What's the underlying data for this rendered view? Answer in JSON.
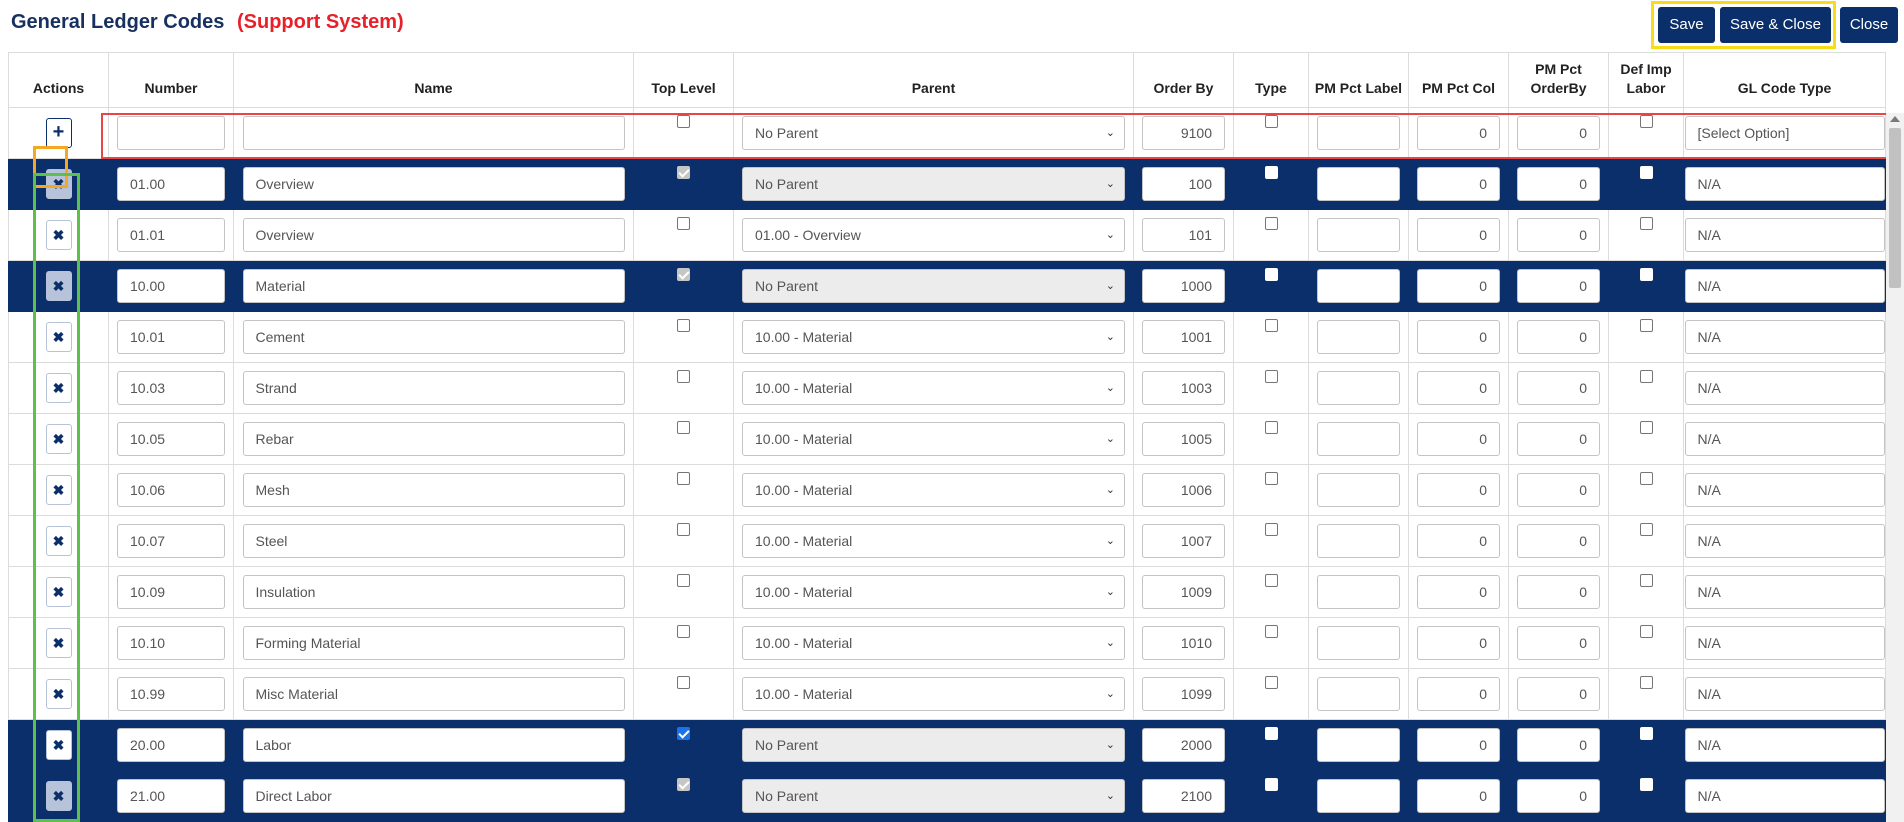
{
  "header": {
    "title": "General Ledger Codes",
    "subtitle": "(Support System)",
    "buttons": {
      "save": "Save",
      "save_close": "Save & Close",
      "close": "Close"
    }
  },
  "columns": [
    "Actions",
    "Number",
    "Name",
    "Top Level",
    "Parent",
    "Order By",
    "Type",
    "PM Pct Label",
    "PM Pct Col",
    "PM Pct OrderBy",
    "Def Imp Labor",
    "GL Code Type"
  ],
  "new_row": {
    "number": "",
    "name": "",
    "parent": "No Parent",
    "order_by": "9100",
    "pm_pct_label": "",
    "pm_pct_col": "0",
    "pm_pct_orderby": "0",
    "gl_code_type": "[Select Option]",
    "add_icon": "plus-icon"
  },
  "rows": [
    {
      "number": "01.00",
      "name": "Overview",
      "top_level": "checked-disabled",
      "parent": "No Parent",
      "order_by": "100",
      "pm_pct_label": "",
      "pm_pct_col": "0",
      "pm_pct_orderby": "0",
      "gl_code_type": "N/A",
      "dark": true
    },
    {
      "number": "01.01",
      "name": "Overview",
      "top_level": "unchecked",
      "parent": "01.00 - Overview",
      "order_by": "101",
      "pm_pct_label": "",
      "pm_pct_col": "0",
      "pm_pct_orderby": "0",
      "gl_code_type": "N/A",
      "dark": false
    },
    {
      "number": "10.00",
      "name": "Material",
      "top_level": "checked-disabled",
      "parent": "No Parent",
      "order_by": "1000",
      "pm_pct_label": "",
      "pm_pct_col": "0",
      "pm_pct_orderby": "0",
      "gl_code_type": "N/A",
      "dark": true
    },
    {
      "number": "10.01",
      "name": "Cement",
      "top_level": "unchecked",
      "parent": "10.00 - Material",
      "order_by": "1001",
      "pm_pct_label": "",
      "pm_pct_col": "0",
      "pm_pct_orderby": "0",
      "gl_code_type": "N/A",
      "dark": false
    },
    {
      "number": "10.03",
      "name": "Strand",
      "top_level": "unchecked",
      "parent": "10.00 - Material",
      "order_by": "1003",
      "pm_pct_label": "",
      "pm_pct_col": "0",
      "pm_pct_orderby": "0",
      "gl_code_type": "N/A",
      "dark": false
    },
    {
      "number": "10.05",
      "name": "Rebar",
      "top_level": "unchecked",
      "parent": "10.00 - Material",
      "order_by": "1005",
      "pm_pct_label": "",
      "pm_pct_col": "0",
      "pm_pct_orderby": "0",
      "gl_code_type": "N/A",
      "dark": false
    },
    {
      "number": "10.06",
      "name": "Mesh",
      "top_level": "unchecked",
      "parent": "10.00 - Material",
      "order_by": "1006",
      "pm_pct_label": "",
      "pm_pct_col": "0",
      "pm_pct_orderby": "0",
      "gl_code_type": "N/A",
      "dark": false
    },
    {
      "number": "10.07",
      "name": "Steel",
      "top_level": "unchecked",
      "parent": "10.00 - Material",
      "order_by": "1007",
      "pm_pct_label": "",
      "pm_pct_col": "0",
      "pm_pct_orderby": "0",
      "gl_code_type": "N/A",
      "dark": false
    },
    {
      "number": "10.09",
      "name": "Insulation",
      "top_level": "unchecked",
      "parent": "10.00 - Material",
      "order_by": "1009",
      "pm_pct_label": "",
      "pm_pct_col": "0",
      "pm_pct_orderby": "0",
      "gl_code_type": "N/A",
      "dark": false
    },
    {
      "number": "10.10",
      "name": "Forming Material",
      "top_level": "unchecked",
      "parent": "10.00 - Material",
      "order_by": "1010",
      "pm_pct_label": "",
      "pm_pct_col": "0",
      "pm_pct_orderby": "0",
      "gl_code_type": "N/A",
      "dark": false
    },
    {
      "number": "10.99",
      "name": "Misc Material",
      "top_level": "unchecked",
      "parent": "10.00 - Material",
      "order_by": "1099",
      "pm_pct_label": "",
      "pm_pct_col": "0",
      "pm_pct_orderby": "0",
      "gl_code_type": "N/A",
      "dark": false
    },
    {
      "number": "20.00",
      "name": "Labor",
      "top_level": "checked",
      "parent": "No Parent",
      "order_by": "2000",
      "pm_pct_label": "",
      "pm_pct_col": "0",
      "pm_pct_orderby": "0",
      "gl_code_type": "N/A",
      "dark": true,
      "white_action": true
    },
    {
      "number": "21.00",
      "name": "Direct Labor",
      "top_level": "checked-disabled",
      "parent": "No Parent",
      "order_by": "2100",
      "pm_pct_label": "",
      "pm_pct_col": "0",
      "pm_pct_orderby": "0",
      "gl_code_type": "N/A",
      "dark": true
    }
  ],
  "colors": {
    "navy": "#0b2f6b",
    "title": "#17305f",
    "subtitle": "#e8202a",
    "highlight_yellow": "#f7dc1b",
    "highlight_orange": "#f5a623",
    "highlight_red": "#e84545",
    "highlight_green": "#5cc04a"
  }
}
